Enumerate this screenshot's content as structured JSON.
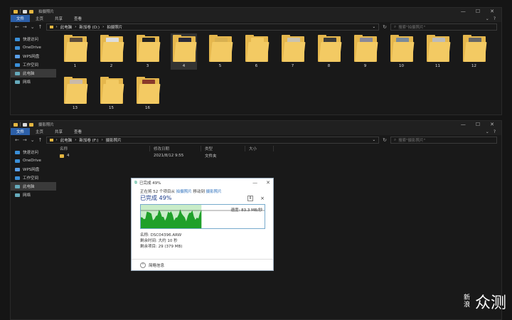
{
  "top": {
    "title": "拍摄照片",
    "tabs": [
      "文件",
      "主页",
      "共享",
      "查看"
    ],
    "path": [
      "此电脑",
      "新加卷 (D:)",
      "拍摄照片"
    ],
    "search_placeholder": "搜索\"拍摄照片\"",
    "sidebar": [
      "快速访问",
      "OneDrive",
      "WPS网盘",
      "工作空间",
      "此电脑",
      "网络"
    ],
    "folders": [
      {
        "label": "1",
        "color": "#5a4a3a"
      },
      {
        "label": "2",
        "color": "#ddd"
      },
      {
        "label": "3",
        "color": "#222"
      },
      {
        "label": "4",
        "color": "#2a2a3a"
      },
      {
        "label": "5",
        "color": "#d8b050"
      },
      {
        "label": "6",
        "color": "#f3ca63"
      },
      {
        "label": "7",
        "color": "#c9c2b0"
      },
      {
        "label": "8",
        "color": "#3a3a3a"
      },
      {
        "label": "9",
        "color": "#889"
      },
      {
        "label": "10",
        "color": "#7a8a9a"
      },
      {
        "label": "11",
        "color": "#bbb"
      },
      {
        "label": "12",
        "color": "#666"
      },
      {
        "label": "13",
        "color": "#c9b9a9"
      },
      {
        "label": "15",
        "color": "#f3ca63"
      },
      {
        "label": "16",
        "color": "#8a3a2a"
      }
    ]
  },
  "bottom": {
    "title": "摄影照片",
    "tabs": [
      "文件",
      "主页",
      "共享",
      "查看"
    ],
    "path": [
      "此电脑",
      "新加卷 (F:)",
      "摄影照片"
    ],
    "search_placeholder": "搜索\"摄影照片\"",
    "sidebar": [
      "快速访问",
      "OneDrive",
      "WPS网盘",
      "工作空间",
      "此电脑",
      "网络"
    ],
    "columns": [
      "名称",
      "修改日期",
      "类型",
      "大小"
    ],
    "rows": [
      {
        "name": "4",
        "date": "2021/8/12 9:55",
        "type": "文件夹",
        "size": ""
      }
    ]
  },
  "dialog": {
    "title": "已完成 49%",
    "line_prefix": "正在将 52 个项目从",
    "line_src": "拍摄照片",
    "line_mid": "移动到",
    "line_dst": "摄影照片",
    "percent": "已完成 49%",
    "progress": 0.49,
    "speed": "速度: 83.3 MB/秒",
    "name": "名称: DSC04396.ARW",
    "remaining_time": "剩余时间: 大约 10 秒",
    "remaining_items": "剩余项目: 29 (379 MB)",
    "less_details": "简略信息",
    "pause_glyph": "II",
    "close_glyph": "×"
  },
  "watermark": {
    "big": "众测",
    "small": "新浪"
  },
  "colors": {
    "accent": "#2c5fa8",
    "folder": "#f3ca63",
    "graph": "#1fa02a"
  },
  "icons": {
    "nav_back": "←",
    "nav_fwd": "→",
    "nav_down": "⌄",
    "nav_up": "↑",
    "refresh": "↻",
    "search": "🔍",
    "min": "—",
    "max": "☐",
    "close": "✕",
    "chevron": "⌃"
  }
}
